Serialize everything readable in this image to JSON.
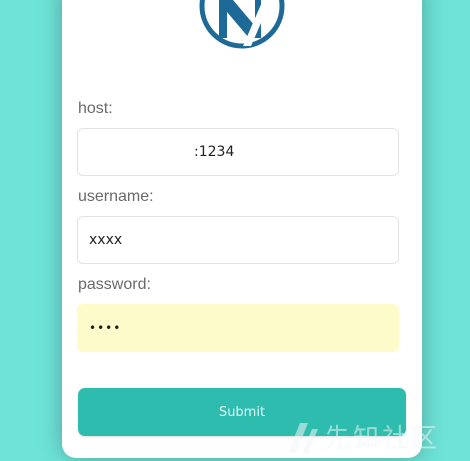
{
  "logo": {
    "icon": "nps-logo-icon",
    "color": "#1d6a98"
  },
  "form": {
    "host_label": "host:",
    "host_value": ":1234",
    "username_label": "username:",
    "username_value": "xxxx",
    "password_label": "password:",
    "password_mask": "••••",
    "submit_label": "Submit"
  },
  "watermark": {
    "text": "先知社区",
    "icon": "xianzhi-logo-icon"
  },
  "colors": {
    "background": "#6ee3d8",
    "submit": "#2ebcae",
    "autofill": "#fefbca"
  }
}
